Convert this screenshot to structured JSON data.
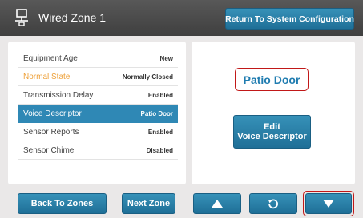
{
  "header": {
    "title": "Wired Zone 1",
    "icon": "wired-zone-icon",
    "return_label": "Return To System Configuration"
  },
  "settings": [
    {
      "label": "Equipment Age",
      "value": "New",
      "state": "normal"
    },
    {
      "label": "Normal State",
      "value": "Normally Closed",
      "state": "warning"
    },
    {
      "label": "Transmission Delay",
      "value": "Enabled",
      "state": "normal"
    },
    {
      "label": "Voice Descriptor",
      "value": "Patio Door",
      "state": "selected"
    },
    {
      "label": "Sensor Reports",
      "value": "Enabled",
      "state": "normal"
    },
    {
      "label": "Sensor Chime",
      "value": "Disabled",
      "state": "normal"
    }
  ],
  "detail": {
    "voice_name": "Patio Door",
    "edit_label_line1": "Edit",
    "edit_label_line2": "Voice Descriptor"
  },
  "footer": {
    "back_label": "Back To Zones",
    "next_label": "Next Zone",
    "up_icon": "arrow-up-icon",
    "reset_icon": "undo-icon",
    "down_icon": "arrow-down-icon"
  },
  "colors": {
    "header_bg": "#4a4a4a",
    "button_blue": "#2a80ab",
    "selected_row": "#2f88b5",
    "warning_text": "#eea13a",
    "highlight_red": "#c11818",
    "voice_name_blue": "#1f7cb0"
  }
}
